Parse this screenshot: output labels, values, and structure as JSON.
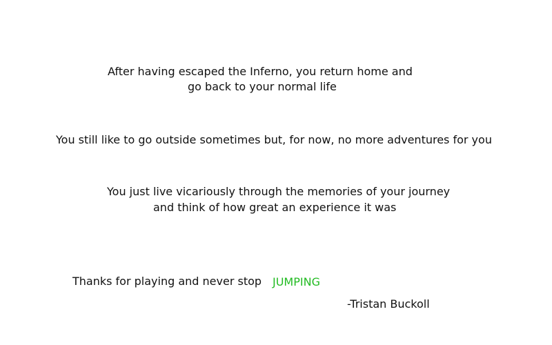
{
  "paragraph1": {
    "line1": "After having escaped the Inferno, you return home and",
    "line2": "go back to your normal life"
  },
  "paragraph2": {
    "line1": "You still like to go outside sometimes but, for now, no more adventures for you"
  },
  "paragraph3": {
    "line1": "You just live vicariously through the memories of your journey",
    "line2": "and think of how great an experience it was"
  },
  "closing": {
    "thanks": "Thanks for playing and never stop",
    "highlight": "JUMPING",
    "signature": "-Tristan Buckoll"
  },
  "colors": {
    "text": "#111111",
    "highlight": "#22bb22",
    "background": "#ffffff"
  }
}
